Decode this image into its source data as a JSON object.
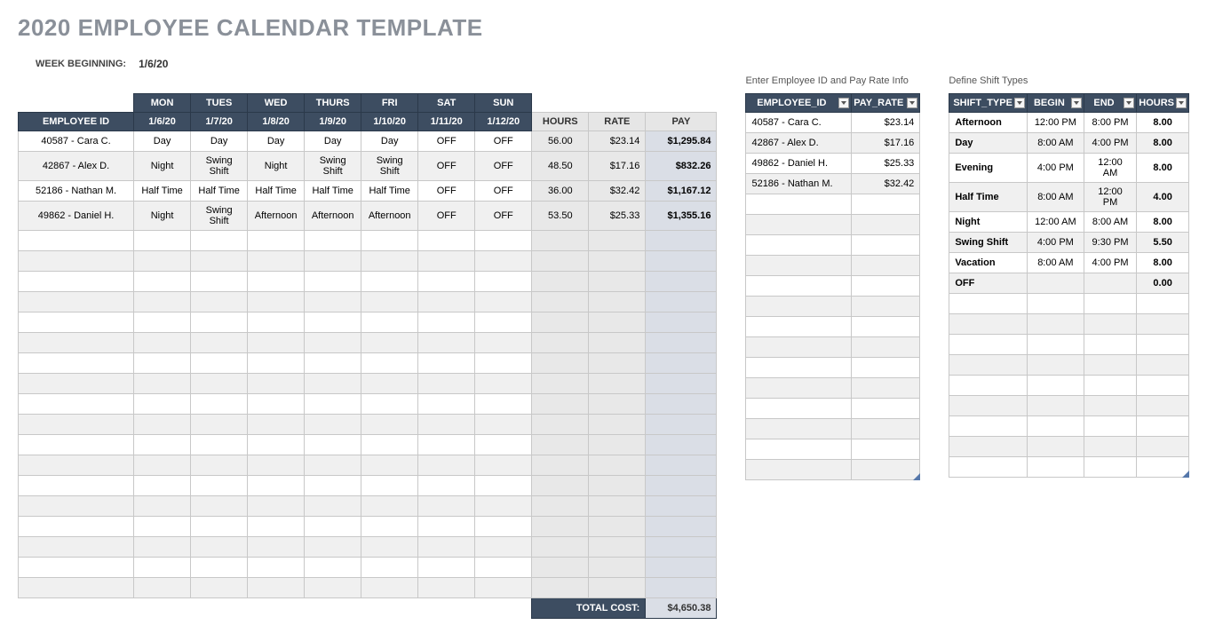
{
  "title": "2020 EMPLOYEE CALENDAR TEMPLATE",
  "week_label": "WEEK BEGINNING:",
  "week_date": "1/6/20",
  "main": {
    "days": [
      "MON",
      "TUES",
      "WED",
      "THURS",
      "FRI",
      "SAT",
      "SUN"
    ],
    "dates": [
      "1/6/20",
      "1/7/20",
      "1/8/20",
      "1/9/20",
      "1/10/20",
      "1/11/20",
      "1/12/20"
    ],
    "emp_header": "EMPLOYEE ID",
    "calc_headers": [
      "HOURS",
      "RATE",
      "PAY"
    ],
    "rows": [
      {
        "emp": "40587 - Cara C.",
        "d": [
          "Day",
          "Day",
          "Day",
          "Day",
          "Day",
          "OFF",
          "OFF"
        ],
        "hours": "56.00",
        "rate": "$23.14",
        "pay": "$1,295.84"
      },
      {
        "emp": "42867 - Alex D.",
        "d": [
          "Night",
          "Swing Shift",
          "Night",
          "Swing Shift",
          "Swing Shift",
          "OFF",
          "OFF"
        ],
        "hours": "48.50",
        "rate": "$17.16",
        "pay": "$832.26"
      },
      {
        "emp": "52186 - Nathan M.",
        "d": [
          "Half Time",
          "Half Time",
          "Half Time",
          "Half Time",
          "Half Time",
          "OFF",
          "OFF"
        ],
        "hours": "36.00",
        "rate": "$32.42",
        "pay": "$1,167.12"
      },
      {
        "emp": "49862 - Daniel H.",
        "d": [
          "Night",
          "Swing Shift",
          "Afternoon",
          "Afternoon",
          "Afternoon",
          "OFF",
          "OFF"
        ],
        "hours": "53.50",
        "rate": "$25.33",
        "pay": "$1,355.16"
      }
    ],
    "empty_rows": 18,
    "total_label": "TOTAL COST:",
    "total_value": "$4,650.38"
  },
  "emp_section": {
    "label": "Enter Employee ID and Pay Rate Info",
    "headers": [
      "EMPLOYEE_ID",
      "PAY_RATE"
    ],
    "rows": [
      {
        "emp": "40587 - Cara C.",
        "rate": "$23.14"
      },
      {
        "emp": "42867 - Alex D.",
        "rate": "$17.16"
      },
      {
        "emp": "49862 - Daniel H.",
        "rate": "$25.33"
      },
      {
        "emp": "52186 - Nathan M.",
        "rate": "$32.42"
      }
    ],
    "empty_rows": 14
  },
  "shift_section": {
    "label": "Define Shift Types",
    "headers": [
      "SHIFT_TYPE",
      "BEGIN",
      "END",
      "HOURS"
    ],
    "rows": [
      {
        "t": "Afternoon",
        "b": "12:00 PM",
        "e": "8:00 PM",
        "h": "8.00"
      },
      {
        "t": "Day",
        "b": "8:00 AM",
        "e": "4:00 PM",
        "h": "8.00"
      },
      {
        "t": "Evening",
        "b": "4:00 PM",
        "e": "12:00 AM",
        "h": "8.00"
      },
      {
        "t": "Half Time",
        "b": "8:00 AM",
        "e": "12:00 PM",
        "h": "4.00"
      },
      {
        "t": "Night",
        "b": "12:00 AM",
        "e": "8:00 AM",
        "h": "8.00"
      },
      {
        "t": "Swing Shift",
        "b": "4:00 PM",
        "e": "9:30 PM",
        "h": "5.50"
      },
      {
        "t": "Vacation",
        "b": "8:00 AM",
        "e": "4:00 PM",
        "h": "8.00"
      },
      {
        "t": "OFF",
        "b": "",
        "e": "",
        "h": "0.00"
      }
    ],
    "empty_rows": 9
  }
}
